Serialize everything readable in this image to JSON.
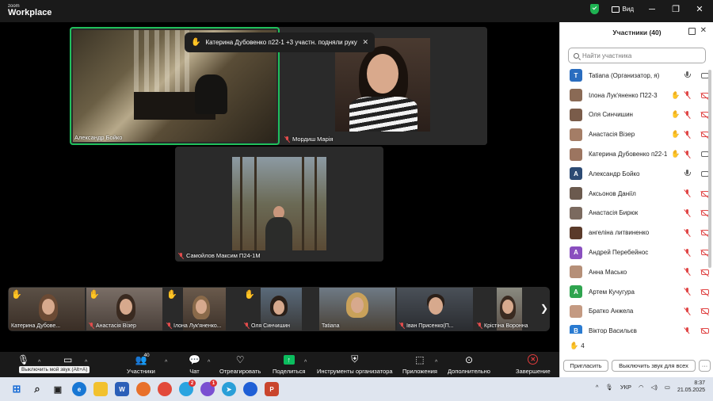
{
  "titlebar": {
    "brand_top": "zoom",
    "brand_bottom": "Workplace",
    "view_label": "Вид"
  },
  "notice": {
    "text": "Катерина Дубовенко п22-1 +3 участн. подняли руку"
  },
  "stage": {
    "tiles": [
      {
        "name": "Александр Бойко",
        "muted": false
      },
      {
        "name": "Мордиш Марія",
        "muted": true
      },
      {
        "name": "Самойлов Максим П24-1М",
        "muted": true
      }
    ]
  },
  "filmstrip": [
    {
      "name": "Катерина Дубове...",
      "hand": true,
      "muted": false
    },
    {
      "name": "Анастасія Візер",
      "hand": true,
      "muted": true
    },
    {
      "name": "Ілона Лук'яненко...",
      "hand": true,
      "muted": true
    },
    {
      "name": "Оля Синчишин",
      "hand": true,
      "muted": true
    },
    {
      "name": "Tatiana",
      "hand": false,
      "muted": false
    },
    {
      "name": "Іван Присенко(П...",
      "hand": false,
      "muted": true
    },
    {
      "name": "Крістіна Воронна",
      "hand": false,
      "muted": true
    }
  ],
  "panel": {
    "title": "Участники (40)",
    "search_placeholder": "Найти участника",
    "participants": [
      {
        "name": "Tatiana (Организатор, я)",
        "initial": "T",
        "color": "#2a6dbf",
        "hand": false,
        "mic": "on",
        "cam": "on"
      },
      {
        "name": "Ілона Лук'яненко П22-3",
        "initial": "",
        "color": "#8a6a55",
        "hand": true,
        "mic": "off",
        "cam": "off"
      },
      {
        "name": "Оля Синчишин",
        "initial": "",
        "color": "#7a5c4a",
        "hand": true,
        "mic": "off",
        "cam": "off"
      },
      {
        "name": "Анастасія Візер",
        "initial": "",
        "color": "#a47d66",
        "hand": true,
        "mic": "off",
        "cam": "off"
      },
      {
        "name": "Катерина Дубовенко п22-1",
        "initial": "",
        "color": "#9c7560",
        "hand": true,
        "mic": "off",
        "cam": "on"
      },
      {
        "name": "Александр Бойко",
        "initial": "A",
        "color": "#2c4a73",
        "hand": false,
        "mic": "on",
        "cam": "on"
      },
      {
        "name": "Аксьонов Даніїл",
        "initial": "",
        "color": "#6b5a4e",
        "hand": false,
        "mic": "off",
        "cam": "off"
      },
      {
        "name": "Анастасія Бирюк",
        "initial": "",
        "color": "#7b6a5f",
        "hand": false,
        "mic": "off",
        "cam": "off"
      },
      {
        "name": "ангеліна литвиненко",
        "initial": "",
        "color": "#5a3a2a",
        "hand": false,
        "mic": "off",
        "cam": "off"
      },
      {
        "name": "Андрей Перебейнос",
        "initial": "A",
        "color": "#8a4fbf",
        "hand": false,
        "mic": "off",
        "cam": "off"
      },
      {
        "name": "Анна Масько",
        "initial": "",
        "color": "#b58f78",
        "hand": false,
        "mic": "off",
        "cam": "off"
      },
      {
        "name": "Артем Кучугура",
        "initial": "A",
        "color": "#2fa44f",
        "hand": false,
        "mic": "off",
        "cam": "off"
      },
      {
        "name": "Братко Анжела",
        "initial": "",
        "color": "#c49a82",
        "hand": false,
        "mic": "off",
        "cam": "off"
      },
      {
        "name": "Віктор Васильєв",
        "initial": "B",
        "color": "#2a7bd1",
        "hand": false,
        "mic": "off",
        "cam": "off"
      }
    ],
    "hands_count": "4",
    "invite_label": "Пригласить",
    "mute_all_label": "Выключить звук для всех",
    "more_label": "···"
  },
  "toolbar": {
    "mute_tooltip": "Выключить мой звук (Alt+A)",
    "video_label": "",
    "participants_label": "Участники",
    "participants_count": "40",
    "chat_label": "Чат",
    "react_label": "Отреагировать",
    "share_label": "Поделиться",
    "host_tools_label": "Инструменты организатора",
    "apps_label": "Приложения",
    "more_label": "Дополнительно",
    "end_label": "Завершение"
  },
  "taskbar": {
    "lang": "УКР",
    "time": "8:37",
    "date": "21.05.2025",
    "badges": {
      "telegram_like": "2",
      "viber_like": "1"
    }
  }
}
